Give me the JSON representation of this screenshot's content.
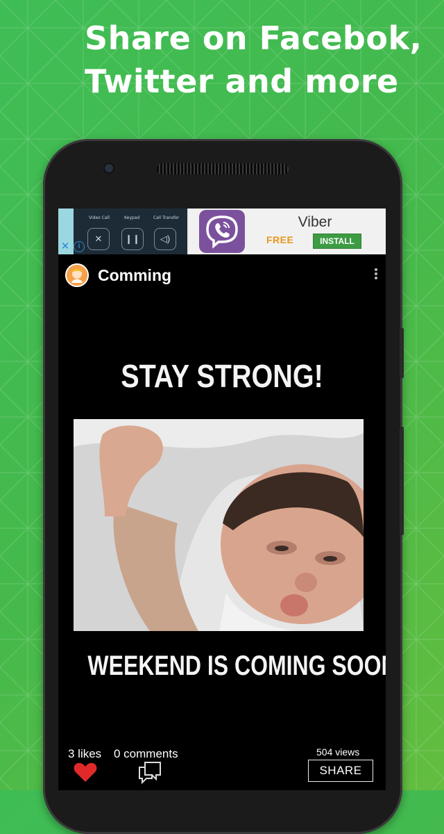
{
  "promo": {
    "headline_line1": "Share on Facebok,",
    "headline_line2": "Twitter and more"
  },
  "ad": {
    "app_name": "Viber",
    "price": "FREE",
    "install_label": "INSTALL",
    "thumb_captions": [
      "Video Call",
      "Keypad",
      "Call Transfer"
    ]
  },
  "post": {
    "title": "Comming",
    "meme_top_text": "STAY STRONG!",
    "meme_bottom_text": "WEEKEND IS COMING SOON",
    "likes": "3 likes",
    "comments": "0 comments",
    "views": "504 views",
    "share_label": "SHARE"
  },
  "colors": {
    "background_green": "#45b94c",
    "heart_red": "#e02a2a",
    "viber_purple": "#7b519d",
    "install_green": "#3d9b43",
    "free_orange": "#e8961c"
  },
  "icons": [
    "close-icon",
    "info-icon",
    "viber-icon",
    "avatar-icon",
    "more-vert-icon",
    "heart-icon",
    "comment-icon"
  ]
}
